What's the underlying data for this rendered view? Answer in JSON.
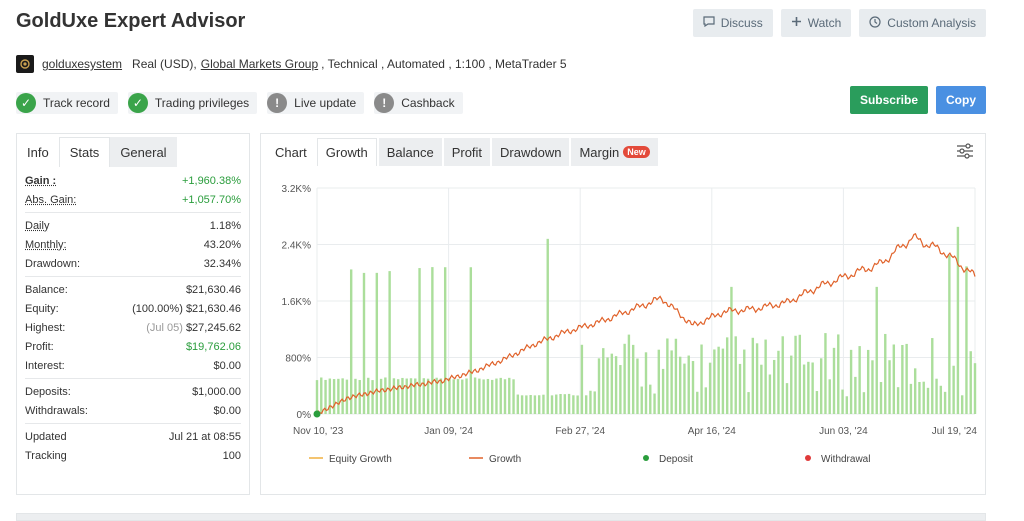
{
  "header": {
    "title": "GoldUxe Expert Advisor",
    "discuss": "Discuss",
    "watch": "Watch",
    "custom_analysis": "Custom Analysis"
  },
  "subline": {
    "username": "golduxesystem",
    "account": "Real (USD),",
    "broker": "Global Markets Group",
    "rest": ", Technical , Automated , 1:100 , MetaTrader 5"
  },
  "badges": [
    {
      "label": "Track record",
      "ok": true
    },
    {
      "label": "Trading privileges",
      "ok": true
    },
    {
      "label": "Live update",
      "ok": false
    },
    {
      "label": "Cashback",
      "ok": false
    }
  ],
  "actions": {
    "subscribe": "Subscribe",
    "copy": "Copy"
  },
  "stats_tabs": [
    "Info",
    "Stats",
    "General"
  ],
  "stats": {
    "gain_label": "Gain :",
    "gain": "+1,960.38%",
    "abs_gain_label": "Abs. Gain:",
    "abs_gain": "+1,057.70%",
    "daily_label": "Daily",
    "daily": "1.18%",
    "monthly_label": "Monthly:",
    "monthly": "43.20%",
    "drawdown_label": "Drawdown:",
    "drawdown": "32.34%",
    "balance_label": "Balance:",
    "balance": "$21,630.46",
    "equity_label": "Equity:",
    "equity_pct": "(100.00%)",
    "equity": "$21,630.46",
    "highest_label": "Highest:",
    "highest_date": "(Jul 05)",
    "highest": "$27,245.62",
    "profit_label": "Profit:",
    "profit": "$19,762.06",
    "interest_label": "Interest:",
    "interest": "$0.00",
    "deposits_label": "Deposits:",
    "deposits": "$1,000.00",
    "withdrawals_label": "Withdrawals:",
    "withdrawals": "$0.00",
    "updated_label": "Updated",
    "updated": "Jul 21 at 08:55",
    "tracking_label": "Tracking",
    "tracking": "100"
  },
  "chart_tabs": {
    "chart": "Chart",
    "growth": "Growth",
    "balance": "Balance",
    "profit": "Profit",
    "drawdown": "Drawdown",
    "margin": "Margin",
    "new": "New"
  },
  "colors": {
    "growth": "#e0622a",
    "equity": "#f0b040",
    "bars": "#a6dc96",
    "deposit": "#2a9d3c",
    "withdrawal": "#e03a3a",
    "accent": "#4a90e2",
    "green_btn": "#2a9d5c"
  },
  "chart_data": {
    "type": "line",
    "x_tick_labels": [
      "Nov 10, '23",
      "Jan 09, '24",
      "Feb 27, '24",
      "Apr 16, '24",
      "Jun 03, '24",
      "Jul 19, '24"
    ],
    "y_tick_labels": [
      "0%",
      "800%",
      "1.6K%",
      "2.4K%",
      "3.2K%"
    ],
    "ylim": [
      0,
      3200
    ],
    "grid": true,
    "legend": [
      "Equity Growth",
      "Growth",
      "Deposit",
      "Withdrawal"
    ],
    "legend_position": "bottom",
    "growth_points": [
      [
        "Nov 10, '23",
        0
      ],
      [
        "Nov 20, '23",
        230
      ],
      [
        "Dec 01, '23",
        330
      ],
      [
        "Dec 15, '23",
        400
      ],
      [
        "Jan 01, '24",
        470
      ],
      [
        "Jan 09, '24",
        600
      ],
      [
        "Jan 20, '24",
        780
      ],
      [
        "Feb 01, '24",
        1000
      ],
      [
        "Feb 10, '24",
        1170
      ],
      [
        "Feb 27, '24",
        1300
      ],
      [
        "Mar 10, '24",
        1470
      ],
      [
        "Mar 20, '24",
        1640
      ],
      [
        "Mar 22, '24",
        1250
      ],
      [
        "Apr 01, '24",
        1450
      ],
      [
        "Apr 16, '24",
        1490
      ],
      [
        "May 01, '24",
        1580
      ],
      [
        "May 15, '24",
        1800
      ],
      [
        "Jun 03, '24",
        1970
      ],
      [
        "Jun 20, '24",
        2130
      ],
      [
        "Jul 05, '24",
        2500
      ],
      [
        "Jul 12, '24",
        2300
      ],
      [
        "Jul 19, '24",
        1950
      ]
    ],
    "deposits": [
      [
        "Nov 10, '23",
        0
      ]
    ],
    "bar_series": "daily bars (light green) ranging roughly 100%–2650%"
  }
}
